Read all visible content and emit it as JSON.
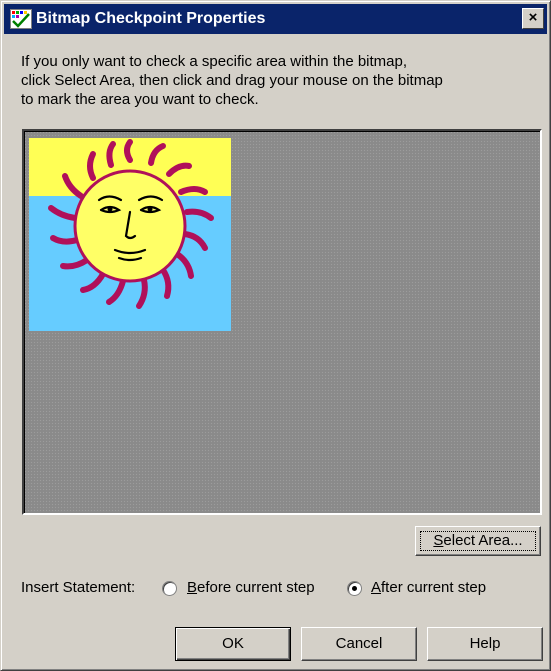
{
  "window": {
    "title": "Bitmap Checkpoint Properties",
    "close_label": "×"
  },
  "instructions": [
    "If you only want to check a specific area within the bitmap,",
    "click Select Area, then click and drag your mouse on the bitmap",
    "to mark the area you want to check."
  ],
  "preview": {
    "image_subject": "sun-face-bitmap",
    "colors": {
      "sky_top": "#ffff55",
      "sky_bottom": "#66ccff",
      "sun": "#ffff66",
      "rays": "#b0105a",
      "outline": "#000000",
      "background": "#8a8a8a"
    }
  },
  "buttons": {
    "select_area_accel": "S",
    "select_area_rest": "elect Area...",
    "ok": "OK",
    "cancel": "Cancel",
    "help": "Help"
  },
  "insert_statement": {
    "label": "Insert Statement:",
    "options": [
      {
        "accel": "B",
        "rest": "efore current step",
        "selected": false
      },
      {
        "accel": "A",
        "rest": "fter current step",
        "selected": true
      }
    ]
  },
  "colors": {
    "titlebar": "#0a246a",
    "face": "#d4d0c8"
  }
}
